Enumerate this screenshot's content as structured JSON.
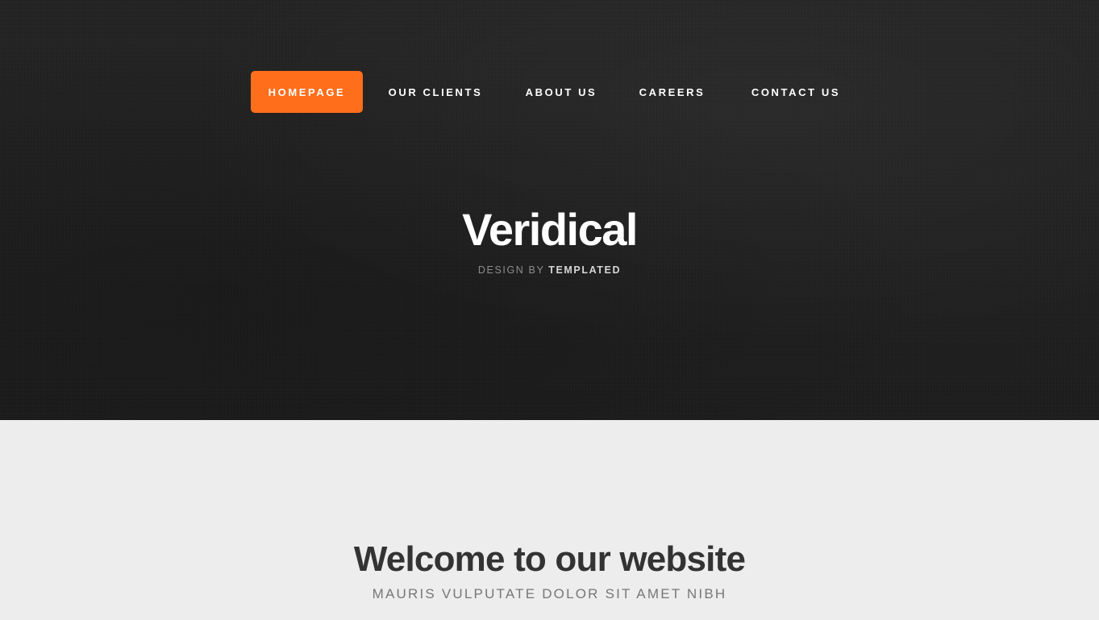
{
  "nav": {
    "items": [
      {
        "label": "HOMEPAGE",
        "active": true
      },
      {
        "label": "OUR CLIENTS",
        "active": false
      },
      {
        "label": "ABOUT US",
        "active": false
      },
      {
        "label": "CAREERS",
        "active": false
      },
      {
        "label": "CONTACT US",
        "active": false
      }
    ]
  },
  "hero": {
    "title": "Veridical",
    "subtitle_prefix": "DESIGN BY",
    "subtitle_brand": "TEMPLATED"
  },
  "welcome": {
    "title": "Welcome to our website",
    "subtitle": "MAURIS VULPUTATE DOLOR SIT AMET NIBH"
  },
  "colors": {
    "accent": "#ff6e1b",
    "header_bg": "#222222",
    "body_bg": "#ededed",
    "heading": "#333333",
    "muted": "#777777"
  }
}
